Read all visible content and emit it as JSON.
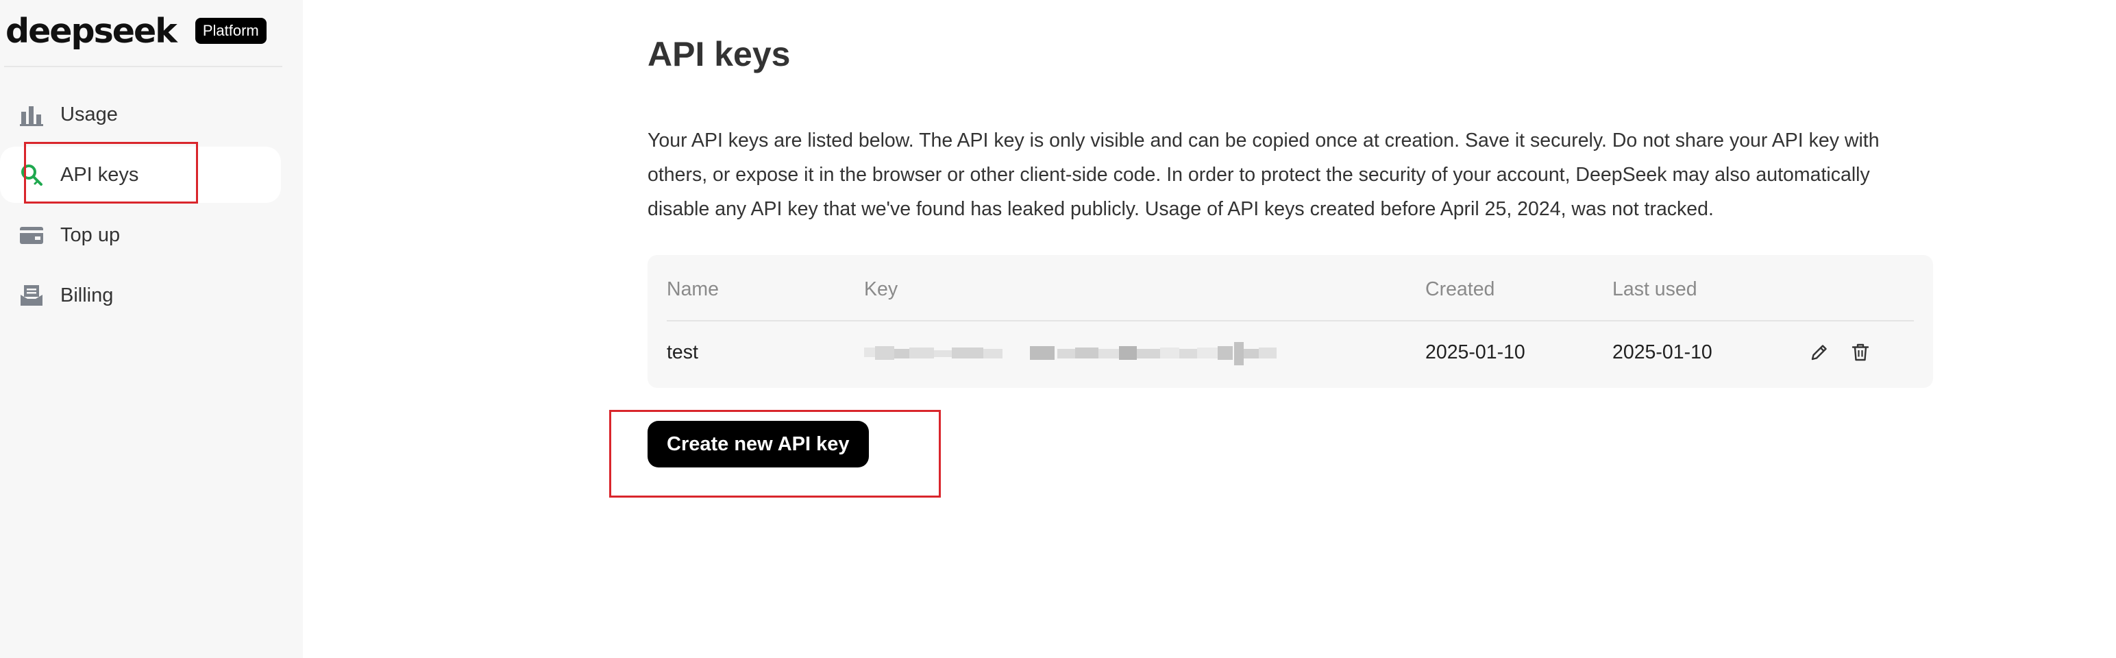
{
  "brand": {
    "name": "deepseek",
    "badge": "Platform"
  },
  "sidebar": {
    "items": [
      {
        "label": "Usage",
        "icon": "bar-chart-icon",
        "active": false
      },
      {
        "label": "API keys",
        "icon": "key-icon",
        "active": true
      },
      {
        "label": "Top up",
        "icon": "card-icon",
        "active": false
      },
      {
        "label": "Billing",
        "icon": "receipt-icon",
        "active": false
      }
    ]
  },
  "main": {
    "title": "API keys",
    "description": "Your API keys are listed below. The API key is only visible and can be copied once at creation. Save it securely. Do not share your API key with others, or expose it in the browser or other client-side code. In order to protect the security of your account, DeepSeek may also automatically disable any API key that we've found has leaked publicly. Usage of API keys created before April 25, 2024, was not tracked.",
    "table": {
      "columns": [
        "Name",
        "Key",
        "Created",
        "Last used"
      ],
      "rows": [
        {
          "name": "test",
          "created": "2025-01-10",
          "last_used": "2025-01-10",
          "actions": [
            "edit-icon",
            "trash-icon"
          ]
        }
      ]
    },
    "create_button": "Create new API key"
  },
  "colors": {
    "sidebar_bg": "#f7f7f7",
    "accent_green": "#1fa84f",
    "button_bg": "#000000",
    "highlight_red": "#d9262c"
  }
}
